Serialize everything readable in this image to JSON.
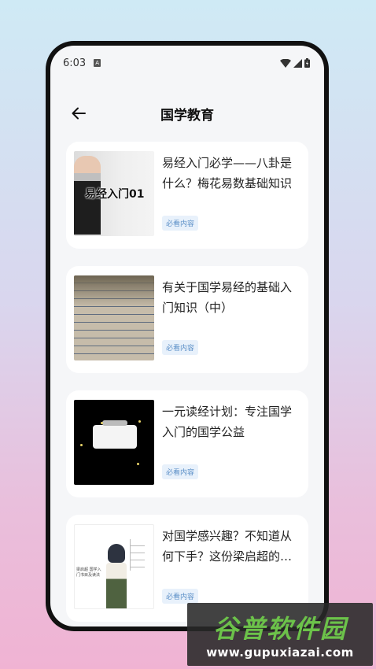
{
  "status_bar": {
    "time": "6:03",
    "notification_glyph": "A"
  },
  "app_bar": {
    "title": "国学教育"
  },
  "articles": [
    {
      "title": "易经入门必学——八卦是什么？梅花易数基础知识",
      "tag": "必看内容",
      "thumbnail_text": "易经入门01"
    },
    {
      "title": "有关于国学易经的基础入门知识（中）",
      "tag": "必看内容"
    },
    {
      "title": "一元读经计划：专注国学入门的国学公益",
      "tag": "必看内容"
    },
    {
      "title": "对国学感兴趣？不知道从何下手？这份梁启超的国学...",
      "tag": "必看内容",
      "thumbnail_text": "梁启超 国学入门书目及读法"
    }
  ],
  "watermark": {
    "brand": "谷普软件园",
    "url": "www.gupuxiazai.com"
  },
  "colors": {
    "accent_tag": "#5b8fc7",
    "tag_bg": "#e8f1fb",
    "brand_green": "#6cc24a"
  }
}
